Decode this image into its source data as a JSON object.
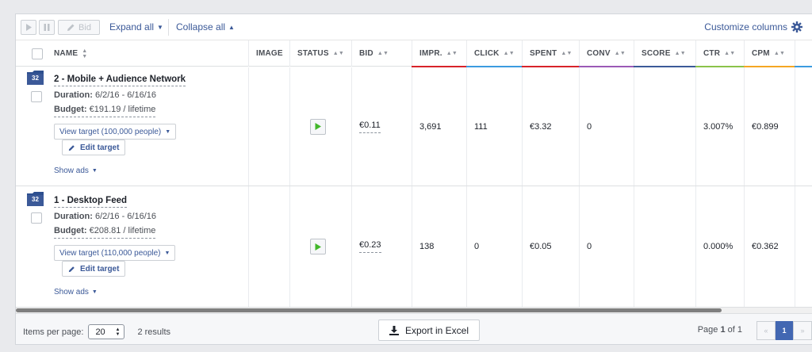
{
  "toolbar": {
    "bid_label": "Bid",
    "expand_all": "Expand all",
    "collapse_all": "Collapse all",
    "customize_columns": "Customize columns"
  },
  "columns": {
    "name": "NAME",
    "image": "IMAGE",
    "status": "STATUS",
    "bid": "BID",
    "impr": "IMPR.",
    "click": "CLICK",
    "spent": "SPENT",
    "conv": "CONV",
    "score": "SCORE",
    "ctr": "CTR",
    "cpm": "CPM"
  },
  "column_colors": {
    "impr": "#d8232a",
    "click": "#3b9be0",
    "spent": "#d8232a",
    "conv": "#9b59b6",
    "score": "#3b5998",
    "ctr": "#8bc34a",
    "cpm": "#f5a623"
  },
  "rows": [
    {
      "badge": "32",
      "name": "2 - Mobile + Audience Network",
      "duration_label": "Duration:",
      "duration": "6/2/16 - 6/16/16",
      "budget_label": "Budget:",
      "budget": "€191.19 / lifetime",
      "view_target": "View target (100,000 people)",
      "edit_target": "Edit target",
      "show_ads": "Show ads",
      "bid": "€0.11",
      "impr": "3,691",
      "click": "111",
      "spent": "€3.32",
      "conv": "0",
      "score": "",
      "ctr": "3.007%",
      "cpm": "€0.899"
    },
    {
      "badge": "32",
      "name": "1 - Desktop Feed",
      "duration_label": "Duration:",
      "duration": "6/2/16 - 6/16/16",
      "budget_label": "Budget:",
      "budget": "€208.81 / lifetime",
      "view_target": "View target (110,000 people)",
      "edit_target": "Edit target",
      "show_ads": "Show ads",
      "bid": "€0.23",
      "impr": "138",
      "click": "0",
      "spent": "€0.05",
      "conv": "0",
      "score": "",
      "ctr": "0.000%",
      "cpm": "€0.362"
    }
  ],
  "footer": {
    "items_per_page_label": "Items per page:",
    "items_per_page_value": "20",
    "results": "2 results",
    "export": "Export in Excel",
    "page_prefix": "Page",
    "page_current": "1",
    "page_of": "of 1",
    "prev": "«",
    "page_button": "1",
    "next": "»"
  }
}
